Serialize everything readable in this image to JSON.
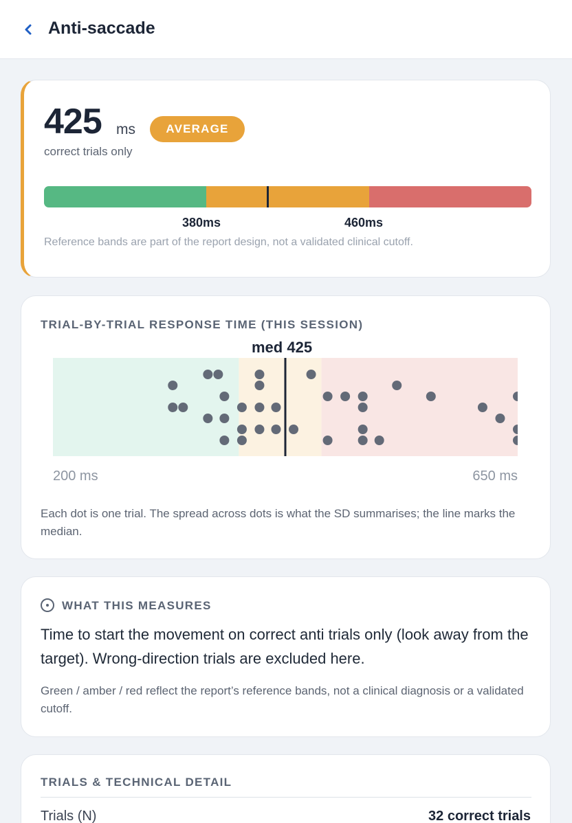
{
  "header": {
    "title": "Anti-saccade",
    "back_icon": "chevron-left-icon"
  },
  "summary": {
    "value": "425",
    "unit": "ms",
    "badge": "AVERAGE",
    "subtitle": "correct trials only",
    "bands": [
      {
        "name": "green",
        "color": "#56b883"
      },
      {
        "name": "amber",
        "color": "#e8a33a"
      },
      {
        "name": "red",
        "color": "#d96e6c"
      }
    ],
    "thresholds": [
      "380ms",
      "460ms"
    ],
    "note": "Reference bands are part of the report design, not a validated clinical cutoff.",
    "accent_color": "#e8a33a"
  },
  "chart_data": {
    "type": "scatter",
    "title": "TRIAL-BY-TRIAL RESPONSE TIME (THIS SESSION)",
    "x_unit": "ms",
    "xlim": [
      200,
      650
    ],
    "x_tick_labels": [
      "200 ms",
      "650 ms"
    ],
    "median_label": "med 425",
    "median": 425,
    "bands": [
      {
        "from": 200,
        "to": 380,
        "color": "#e3f5ee"
      },
      {
        "from": 380,
        "to": 460,
        "color": "#fcf2e1"
      },
      {
        "from": 460,
        "to": 650,
        "color": "#f9e6e4"
      }
    ],
    "point_color": "#636a77",
    "points": [
      316,
      316,
      326,
      350,
      350,
      360,
      366,
      366,
      366,
      383,
      383,
      383,
      400,
      400,
      400,
      400,
      416,
      416,
      433,
      450,
      466,
      466,
      483,
      500,
      500,
      500,
      500,
      516,
      533,
      566,
      616,
      633,
      650,
      650,
      650
    ]
  },
  "chart_caption": "Each dot is one trial. The spread across dots is what the SD summarises; the line marks the median.",
  "measures": {
    "heading": "WHAT THIS MEASURES",
    "icon": "info-icon",
    "text": "Time to start the movement on correct anti trials only (look away from the target). Wrong-direction trials are excluded here.",
    "note": "Green / amber / red reflect the report’s reference bands, not a clinical diagnosis or a validated cutoff."
  },
  "details": {
    "heading": "TRIALS & TECHNICAL DETAIL",
    "rows": [
      {
        "label": "Trials (N)",
        "value": "32 correct trials"
      }
    ]
  }
}
